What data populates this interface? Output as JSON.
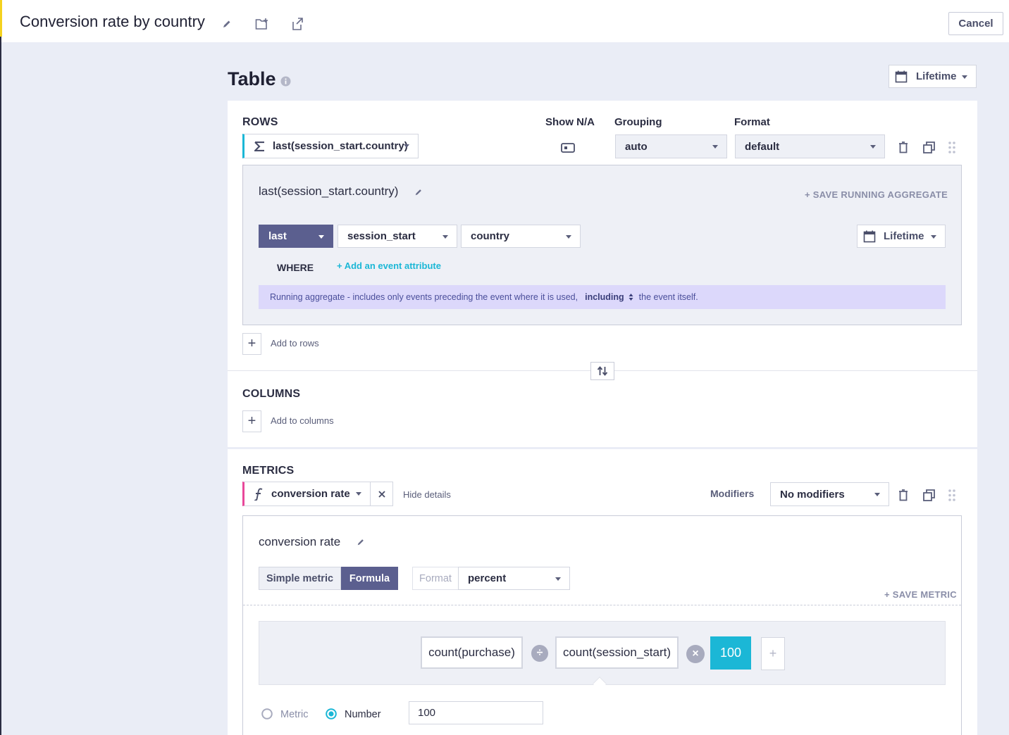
{
  "header": {
    "title": "Conversion rate by country",
    "cancel_label": "Cancel"
  },
  "page": {
    "title": "Table",
    "date_range": "Lifetime"
  },
  "rows": {
    "label": "ROWS",
    "chip": "last(session_start.country)",
    "show_na_label": "Show N/A",
    "grouping_label": "Grouping",
    "grouping_value": "auto",
    "format_label": "Format",
    "format_value": "default",
    "panel": {
      "title": "last(session_start.country)",
      "save_label": "+ SAVE RUNNING AGGREGATE",
      "func": "last",
      "event": "session_start",
      "attribute": "country",
      "date_range": "Lifetime",
      "where_label": "WHERE",
      "add_attribute": "+ Add an event attribute",
      "note_pre": "Running aggregate - includes only events preceding the event where it is used,",
      "note_mode": "including",
      "note_post": "the event itself."
    },
    "add_label": "Add to rows"
  },
  "columns": {
    "label": "COLUMNS",
    "add_label": "Add to columns"
  },
  "metrics": {
    "label": "METRICS",
    "chip": "conversion rate",
    "hide_details": "Hide details",
    "modifiers_label": "Modifiers",
    "modifiers_value": "No modifiers",
    "panel": {
      "title": "conversion rate",
      "tab_simple": "Simple metric",
      "tab_formula": "Formula",
      "format_label": "Format",
      "format_value": "percent",
      "save_label": "+ SAVE METRIC",
      "formula": {
        "operand1": "count(purchase)",
        "operator1": "÷",
        "operand2": "count(session_start)",
        "operator2": "×",
        "number": "100",
        "add": "+"
      },
      "radio_metric": "Metric",
      "radio_number": "Number",
      "number_value": "100"
    }
  },
  "colors": {
    "accent": "#1bb7d6",
    "dark_purple": "#5b5f8f",
    "note_bg": "#dcd8fb",
    "yellow": "#f4d21f",
    "pink": "#e8489a"
  }
}
